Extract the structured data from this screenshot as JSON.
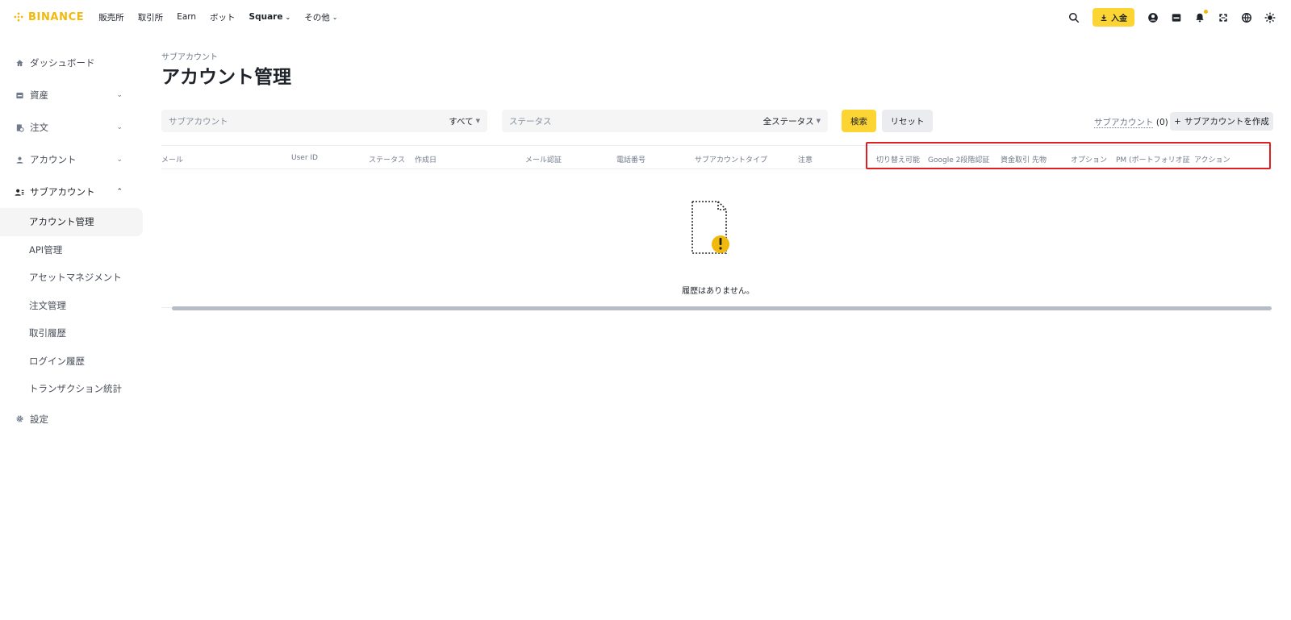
{
  "header": {
    "logo_text": "BINANCE",
    "nav": [
      {
        "label": "販売所"
      },
      {
        "label": "取引所"
      },
      {
        "label": "Earn"
      },
      {
        "label": "ボット"
      },
      {
        "label": "Square"
      },
      {
        "label": "その他"
      }
    ],
    "deposit_label": "入金",
    "accent_color": "#fcd535",
    "icons": [
      "search-icon",
      "download-icon",
      "user-icon",
      "wallet-icon",
      "bell-icon",
      "scan-icon",
      "globe-icon",
      "theme-icon"
    ]
  },
  "sidebar": {
    "items": [
      {
        "label": "ダッシュボード",
        "icon": "home-icon"
      },
      {
        "label": "資産",
        "icon": "wallet-icon"
      },
      {
        "label": "注文",
        "icon": "order-icon"
      },
      {
        "label": "アカウント",
        "icon": "user-icon"
      },
      {
        "label": "サブアカウント",
        "icon": "sub-account-icon"
      }
    ],
    "sub_items": [
      {
        "label": "アカウント管理"
      },
      {
        "label": "API管理"
      },
      {
        "label": "アセットマネジメント"
      },
      {
        "label": "注文管理"
      },
      {
        "label": "取引履歴"
      },
      {
        "label": "ログイン履歴"
      },
      {
        "label": "トランザクション統計"
      }
    ],
    "settings": {
      "label": "設定",
      "icon": "gear-icon"
    }
  },
  "main": {
    "breadcrumb": "サブアカウント",
    "title": "アカウント管理",
    "filters": {
      "subaccount_placeholder": "サブアカウント",
      "subaccount_value": "すべて",
      "status_placeholder": "ステータス",
      "status_value": "全ステータス"
    },
    "search_label": "検索",
    "reset_label": "リセット",
    "sub_count_label": "サブアカウント",
    "sub_count_value": "(0)",
    "create_label": "サブアカウントを作成",
    "columns": [
      "メール",
      "User ID",
      "ステータス",
      "作成日",
      "メール認証",
      "電話番号",
      "サブアカウントタイプ",
      "注意",
      "切り替え可能",
      "Google 2段階認証",
      "資金取引",
      "先物",
      "オプション",
      "PM (ポートフォリオ証",
      "アクション"
    ],
    "empty_text": "履歴はありません。"
  }
}
